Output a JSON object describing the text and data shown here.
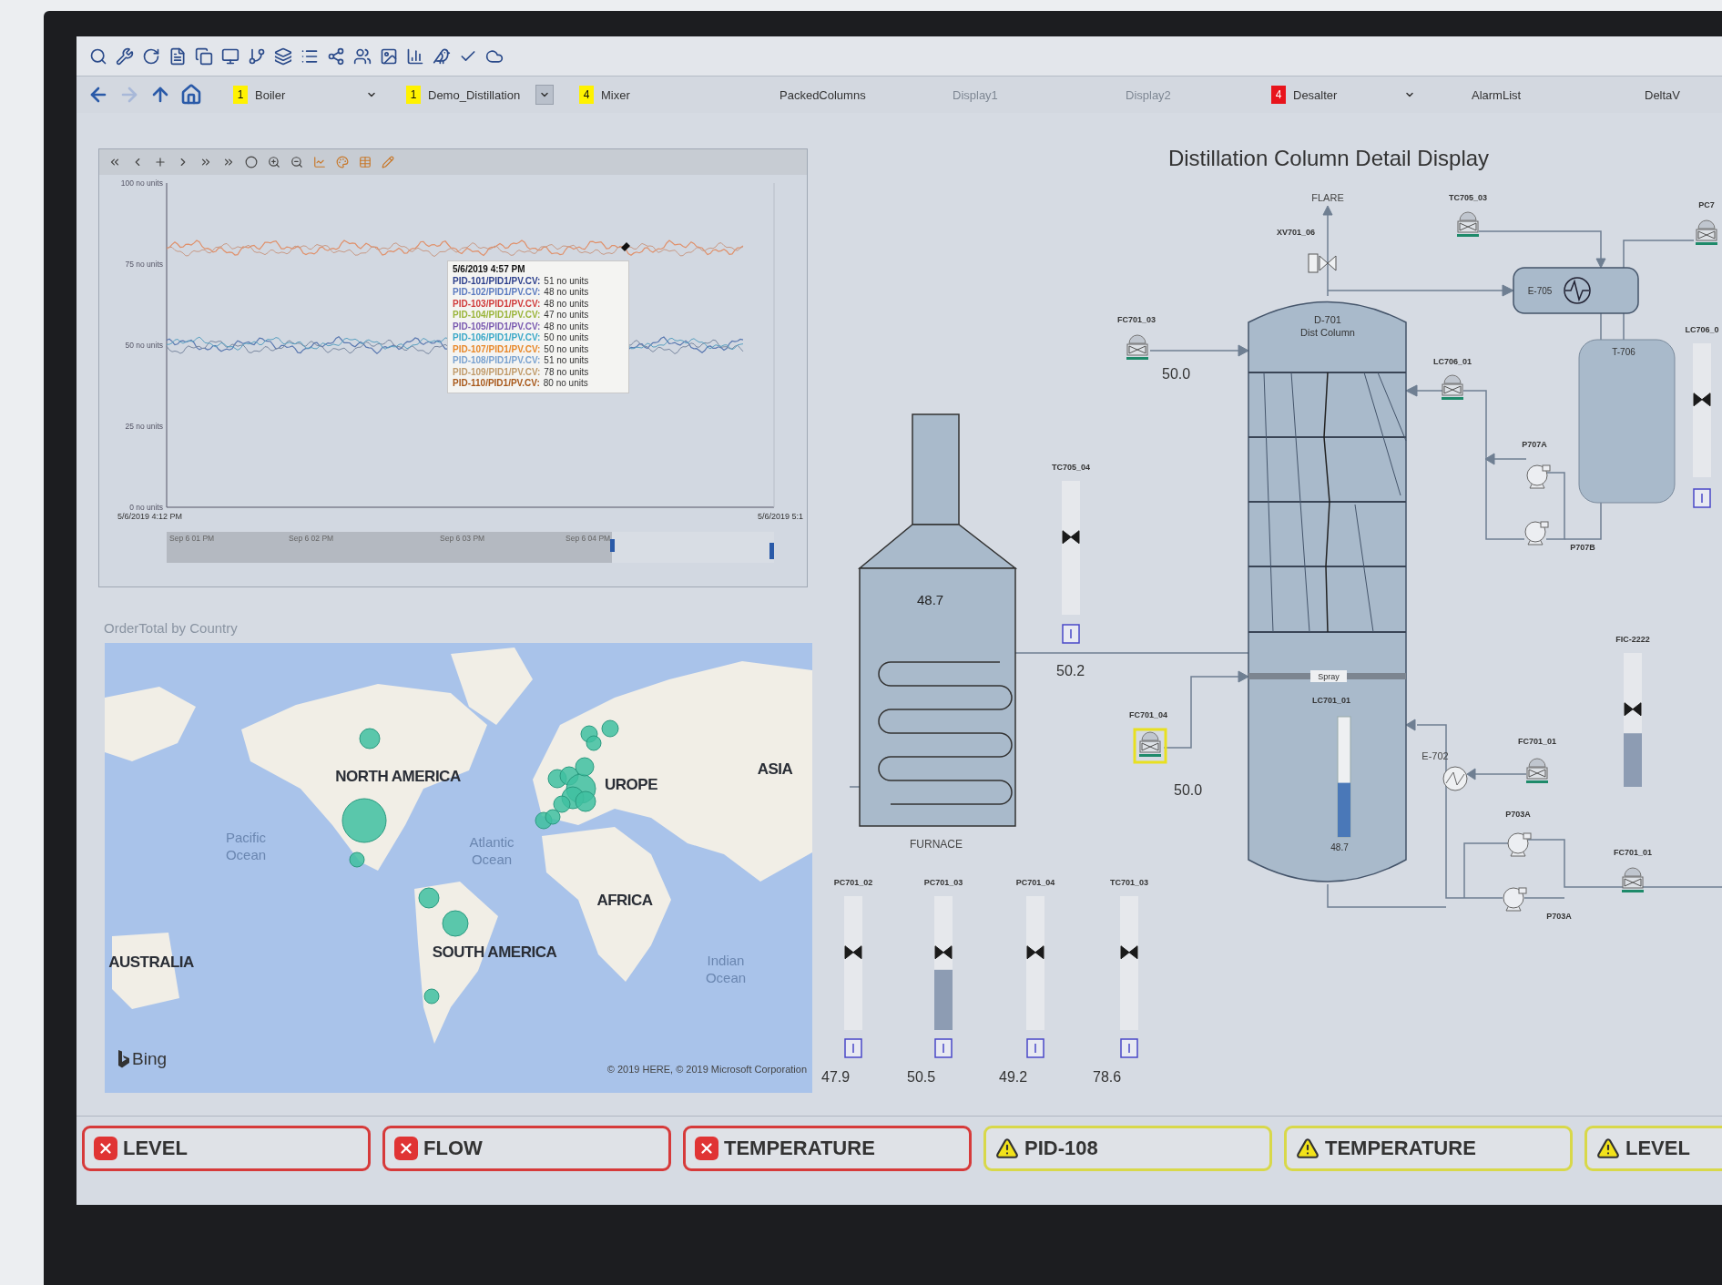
{
  "nav": {
    "items": [
      {
        "label": "Boiler",
        "badge": {
          "count": "1",
          "color": "#fff200"
        },
        "dropdown": true,
        "selected": false,
        "disabled": false
      },
      {
        "label": "Demo_Distillation",
        "badge": {
          "count": "1",
          "color": "#fff200"
        },
        "dropdown": true,
        "selected": true,
        "disabled": false
      },
      {
        "label": "Mixer",
        "badge": {
          "count": "4",
          "color": "#fff200"
        },
        "dropdown": false,
        "disabled": false
      },
      {
        "label": "PackedColumns",
        "dropdown": false,
        "disabled": false
      },
      {
        "label": "Display1",
        "dropdown": false,
        "disabled": true
      },
      {
        "label": "Display2",
        "dropdown": false,
        "disabled": true
      },
      {
        "label": "Desalter",
        "badge": {
          "count": "4",
          "color": "#e8141c"
        },
        "dropdown": true,
        "selected": false,
        "disabled": false
      },
      {
        "label": "AlarmList",
        "dropdown": false,
        "disabled": false
      },
      {
        "label": "DeltaV",
        "dropdown": false,
        "disabled": false
      }
    ]
  },
  "trend": {
    "y_ticks": [
      "100 no units",
      "75 no units",
      "50 no units",
      "25 no units",
      "0 no units"
    ],
    "x_start": "5/6/2019 4:12 PM",
    "x_end": "5/6/2019 5:1",
    "navigator_labels": [
      "Sep 6 01 PM",
      "Sep 6 02 PM",
      "Sep 6 03 PM",
      "Sep 6 04 PM"
    ],
    "tooltip": {
      "time": "5/6/2019 4:57 PM",
      "rows": [
        {
          "tag": "PID-101/PID1/PV.CV:",
          "value": "51 no units",
          "color": "#2c3f8c"
        },
        {
          "tag": "PID-102/PID1/PV.CV:",
          "value": "48 no units",
          "color": "#5a7ac0"
        },
        {
          "tag": "PID-103/PID1/PV.CV:",
          "value": "48 no units",
          "color": "#d03a3a"
        },
        {
          "tag": "PID-104/PID1/PV.CV:",
          "value": "47 no units",
          "color": "#9ab43a"
        },
        {
          "tag": "PID-105/PID1/PV.CV:",
          "value": "48 no units",
          "color": "#7a5ab0"
        },
        {
          "tag": "PID-106/PID1/PV.CV:",
          "value": "50 no units",
          "color": "#3aa8c8"
        },
        {
          "tag": "PID-107/PID1/PV.CV:",
          "value": "50 no units",
          "color": "#e8882a"
        },
        {
          "tag": "PID-108/PID1/PV.CV:",
          "value": "51 no units",
          "color": "#7aa2d0"
        },
        {
          "tag": "PID-109/PID1/PV.CV:",
          "value": "78 no units",
          "color": "#c09a6a"
        },
        {
          "tag": "PID-110/PID1/PV.CV:",
          "value": "80 no units",
          "color": "#a8581a"
        }
      ]
    }
  },
  "map": {
    "title": "OrderTotal by Country",
    "labels": [
      {
        "text": "NORTH AMERICA",
        "kind": "continent"
      },
      {
        "text": "UROPE",
        "kind": "continent"
      },
      {
        "text": "ASIA",
        "kind": "continent"
      },
      {
        "text": "Pacific Ocean",
        "kind": "ocean"
      },
      {
        "text": "Atlantic Ocean",
        "kind": "ocean"
      },
      {
        "text": "AFRICA",
        "kind": "continent"
      },
      {
        "text": "SOUTH AMERICA",
        "kind": "continent"
      },
      {
        "text": "AUSTRALIA",
        "kind": "continent"
      },
      {
        "text": "Indian Ocean",
        "kind": "ocean"
      }
    ],
    "provider": "Bing",
    "attribution": "© 2019 HERE, © 2019 Microsoft Corporation"
  },
  "diagram": {
    "title": "Distillation Column Detail Display",
    "flare": "FLARE",
    "vent_valve": "XV701_06",
    "heat_exchangers": [
      "E-705",
      "E-702"
    ],
    "tank": "T-706",
    "column": {
      "name": "D-701",
      "subtitle": "Dist Column",
      "spray": "Spray",
      "level_tag": "LC701_01",
      "level_value": "48.7",
      "level": 0.45
    },
    "furnace": {
      "name": "FURNACE",
      "value": "48.7"
    },
    "pumps": [
      "P707A",
      "P707B",
      "P703A",
      "P703A"
    ],
    "instruments": [
      {
        "tag": "FC701_03",
        "value": "50.0",
        "highlighted": false
      },
      {
        "tag": "TC705_03",
        "highlighted": false
      },
      {
        "tag": "LC706_01",
        "highlighted": false
      },
      {
        "tag": "FC701_04",
        "value": "50.0",
        "highlighted": true
      },
      {
        "tag": "FC701_01",
        "highlighted": false
      },
      {
        "tag": "FC701_01",
        "highlighted": false
      },
      {
        "tag": "PC7",
        "highlighted": false
      }
    ],
    "sliders": [
      {
        "tag": "TC705_04",
        "value": "50.2"
      },
      {
        "tag": "FIC-2222",
        "level": 0.4
      },
      {
        "tag": "LC706_0"
      },
      {
        "tag": "PC701_02",
        "value": "47.9"
      },
      {
        "tag": "PC701_03",
        "value": "50.5",
        "level": 0.45
      },
      {
        "tag": "PC701_04",
        "value": "49.2"
      },
      {
        "tag": "TC701_03",
        "value": "78.6"
      }
    ]
  },
  "alarms": [
    {
      "label": "LEVEL",
      "kind": "error"
    },
    {
      "label": "FLOW",
      "kind": "error"
    },
    {
      "label": "TEMPERATURE",
      "kind": "error"
    },
    {
      "label": "PID-108",
      "kind": "warning"
    },
    {
      "label": "TEMPERATURE",
      "kind": "warning"
    },
    {
      "label": "LEVEL",
      "kind": "warning"
    }
  ]
}
